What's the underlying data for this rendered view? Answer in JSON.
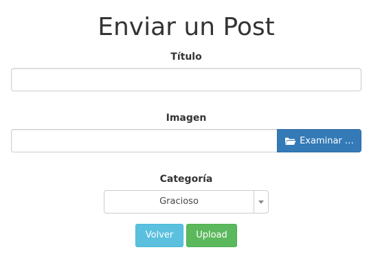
{
  "page": {
    "title": "Enviar un Post"
  },
  "form": {
    "titulo": {
      "label": "Título",
      "value": ""
    },
    "imagen": {
      "label": "Imagen",
      "file_caption": "",
      "browse_label": "Examinar …",
      "browse_icon": "folder-open-icon"
    },
    "categoria": {
      "label": "Categoría",
      "selected": "Gracioso"
    },
    "buttons": {
      "back_label": "Volver",
      "upload_label": "Upload"
    }
  },
  "colors": {
    "primary": "#337ab7",
    "info": "#5bc0de",
    "success": "#5cb85c",
    "text": "#333333",
    "border": "#cccccc"
  }
}
